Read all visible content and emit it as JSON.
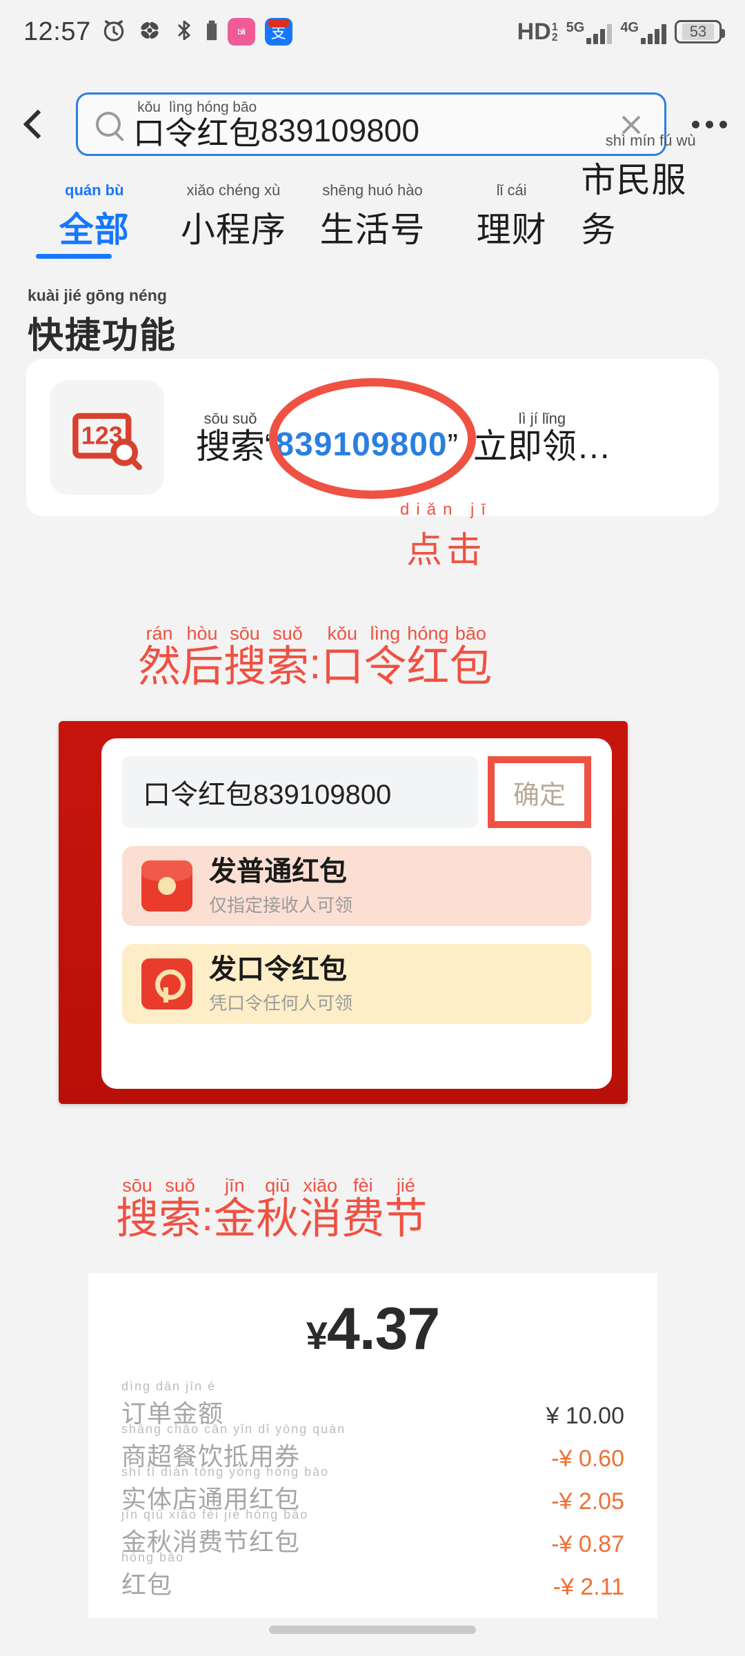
{
  "status_bar": {
    "time": "12:57",
    "icons": [
      "alarm-icon",
      "fan-icon",
      "bluetooth-icon",
      "bili-app-icon",
      "alipay-app-icon"
    ],
    "hd_label": "HD",
    "hd_sub_top": "1",
    "hd_sub_bottom": "2",
    "net_5g": "5G",
    "net_4g": "4G",
    "battery_percent": "53"
  },
  "header": {
    "back_icon": "back-chevron-icon",
    "search_icon": "search-icon",
    "clear_icon": "clear-icon",
    "more_icon": "more-options-icon",
    "query_pinyin": [
      "kǒu",
      "lìng",
      "hóng",
      "bāo"
    ],
    "query_hanzi": [
      "口",
      "令",
      "红",
      "包"
    ],
    "query_suffix": "839109800",
    "query_full": "口令红包839109800"
  },
  "tabs": [
    {
      "pinyin": "quán bù",
      "label": "全部",
      "active": true
    },
    {
      "pinyin": "xiǎo chéng xù",
      "label": "小程序",
      "active": false
    },
    {
      "pinyin": "shēng huó hào",
      "label": "生活号",
      "active": false
    },
    {
      "pinyin": "lǐ cái",
      "label": "理财",
      "active": false
    },
    {
      "pinyin": "shì mín fú wù",
      "label": "市民服务",
      "active": false
    }
  ],
  "section": {
    "title_pinyin": "kuài jié gōng néng",
    "title": "快捷功能"
  },
  "quick_card": {
    "icon": "number-search-icon",
    "icon_text": "123",
    "prefix_pinyin": "sōu suǒ",
    "prefix": "搜索",
    "open_quote": "“",
    "code": "839109800",
    "close_quote": "”",
    "suffix_pinyin": "lì jí lǐng",
    "suffix": "立即领…"
  },
  "annotations": {
    "click_pinyin": "diǎn jī",
    "click": "点击",
    "then_search_pinyin": [
      "rán",
      "hòu",
      "sōu",
      "suǒ",
      "kǒu",
      "lìng",
      "hóng",
      "bāo"
    ],
    "then_search_hanzi": [
      "然",
      "后",
      "搜",
      "索",
      ":",
      "口",
      "令",
      "红",
      "包"
    ],
    "then_search_text": "然后搜索:口令红包",
    "search_festival_pinyin": [
      "sōu",
      "suǒ",
      "jīn",
      "qiū",
      "xiāo",
      "fèi",
      "jié"
    ],
    "search_festival_hanzi": [
      "搜",
      "索",
      ":",
      "金",
      "秋",
      "消",
      "费",
      "节"
    ],
    "search_festival_text": "搜索:金秋消费节",
    "accent_color": "#ef5142"
  },
  "redpacket_dialog": {
    "input_value": "口令红包839109800",
    "confirm_label": "确定",
    "options": [
      {
        "icon": "red-envelope-icon",
        "title": "发普通红包",
        "subtitle": "仅指定接收人可领"
      },
      {
        "icon": "token-key-icon",
        "title": "发口令红包",
        "subtitle": "凭口令任何人可领"
      }
    ]
  },
  "receipt": {
    "total_symbol": "¥",
    "total_amount": "4.37",
    "rows": [
      {
        "pinyin": "dìng dān jīn é",
        "label": "订单金额",
        "value": "¥ 10.00",
        "negative": false
      },
      {
        "pinyin": "shāng chāo cān yǐn dǐ yòng quàn",
        "label": "商超餐饮抵用券",
        "value": "-¥ 0.60",
        "negative": true
      },
      {
        "pinyin": "shí tǐ diàn tōng yòng hóng bāo",
        "label": "实体店通用红包",
        "value": "-¥ 2.05",
        "negative": true
      },
      {
        "pinyin": "jīn qiū xiāo fèi jié hóng bāo",
        "label": "金秋消费节红包",
        "value": "-¥ 0.87",
        "negative": true
      },
      {
        "pinyin": "hóng bāo",
        "label": "红包",
        "value": "-¥ 2.11",
        "negative": true
      }
    ]
  },
  "system": {
    "home_indicator": "home-indicator"
  }
}
